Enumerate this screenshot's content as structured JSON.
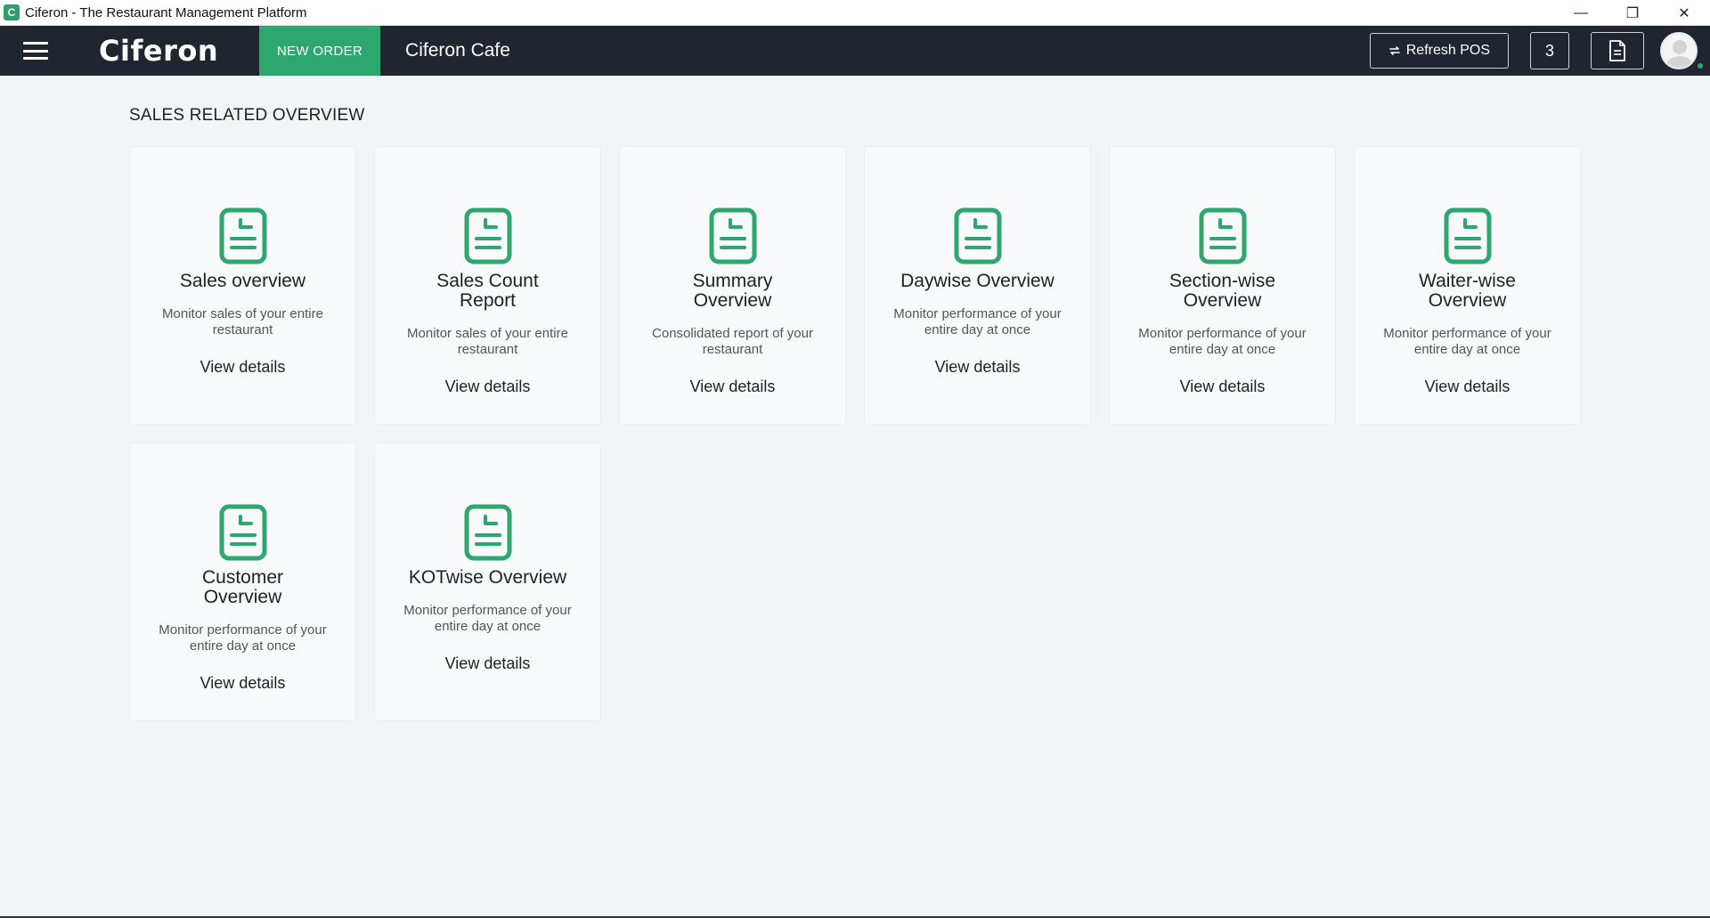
{
  "window": {
    "title": "Ciferon - The Restaurant Management Platform",
    "app_icon_glyph": "C",
    "controls": [
      "minimize-icon",
      "restore-icon",
      "close-icon"
    ]
  },
  "navbar": {
    "brand": "Ciferon",
    "new_order_label": "NEW ORDER",
    "cafe_name": "Ciferon Cafe",
    "refresh_label": "Refresh POS",
    "count": "3",
    "accent_color": "#2ea66f",
    "background_color": "#1f2630"
  },
  "main": {
    "section_title": "SALES RELATED OVERVIEW",
    "cards": [
      {
        "title": "Sales overview",
        "desc": "Monitor sales of your entire restaurant",
        "link": "View details",
        "icon": "report-icon"
      },
      {
        "title": "Sales Count Report",
        "desc": "Monitor sales of your entire restaurant",
        "link": "View details",
        "icon": "report-icon"
      },
      {
        "title": "Summary Overview",
        "desc": "Consolidated report of your restaurant",
        "link": "View details",
        "icon": "report-icon"
      },
      {
        "title": "Daywise Overview",
        "desc": "Monitor performance of your entire day at once",
        "link": "View details",
        "icon": "report-icon"
      },
      {
        "title": "Section-wise Overview",
        "desc": "Monitor performance of your entire day at once",
        "link": "View details",
        "icon": "report-icon"
      },
      {
        "title": "Waiter-wise Overview",
        "desc": "Monitor performance of your entire day at once",
        "link": "View details",
        "icon": "report-icon"
      },
      {
        "title": "Customer Overview",
        "desc": "Monitor performance of your entire day at once",
        "link": "View details",
        "icon": "report-icon"
      },
      {
        "title": "KOTwise Overview",
        "desc": "Monitor performance of your entire day at once",
        "link": "View details",
        "icon": "report-icon"
      }
    ]
  }
}
